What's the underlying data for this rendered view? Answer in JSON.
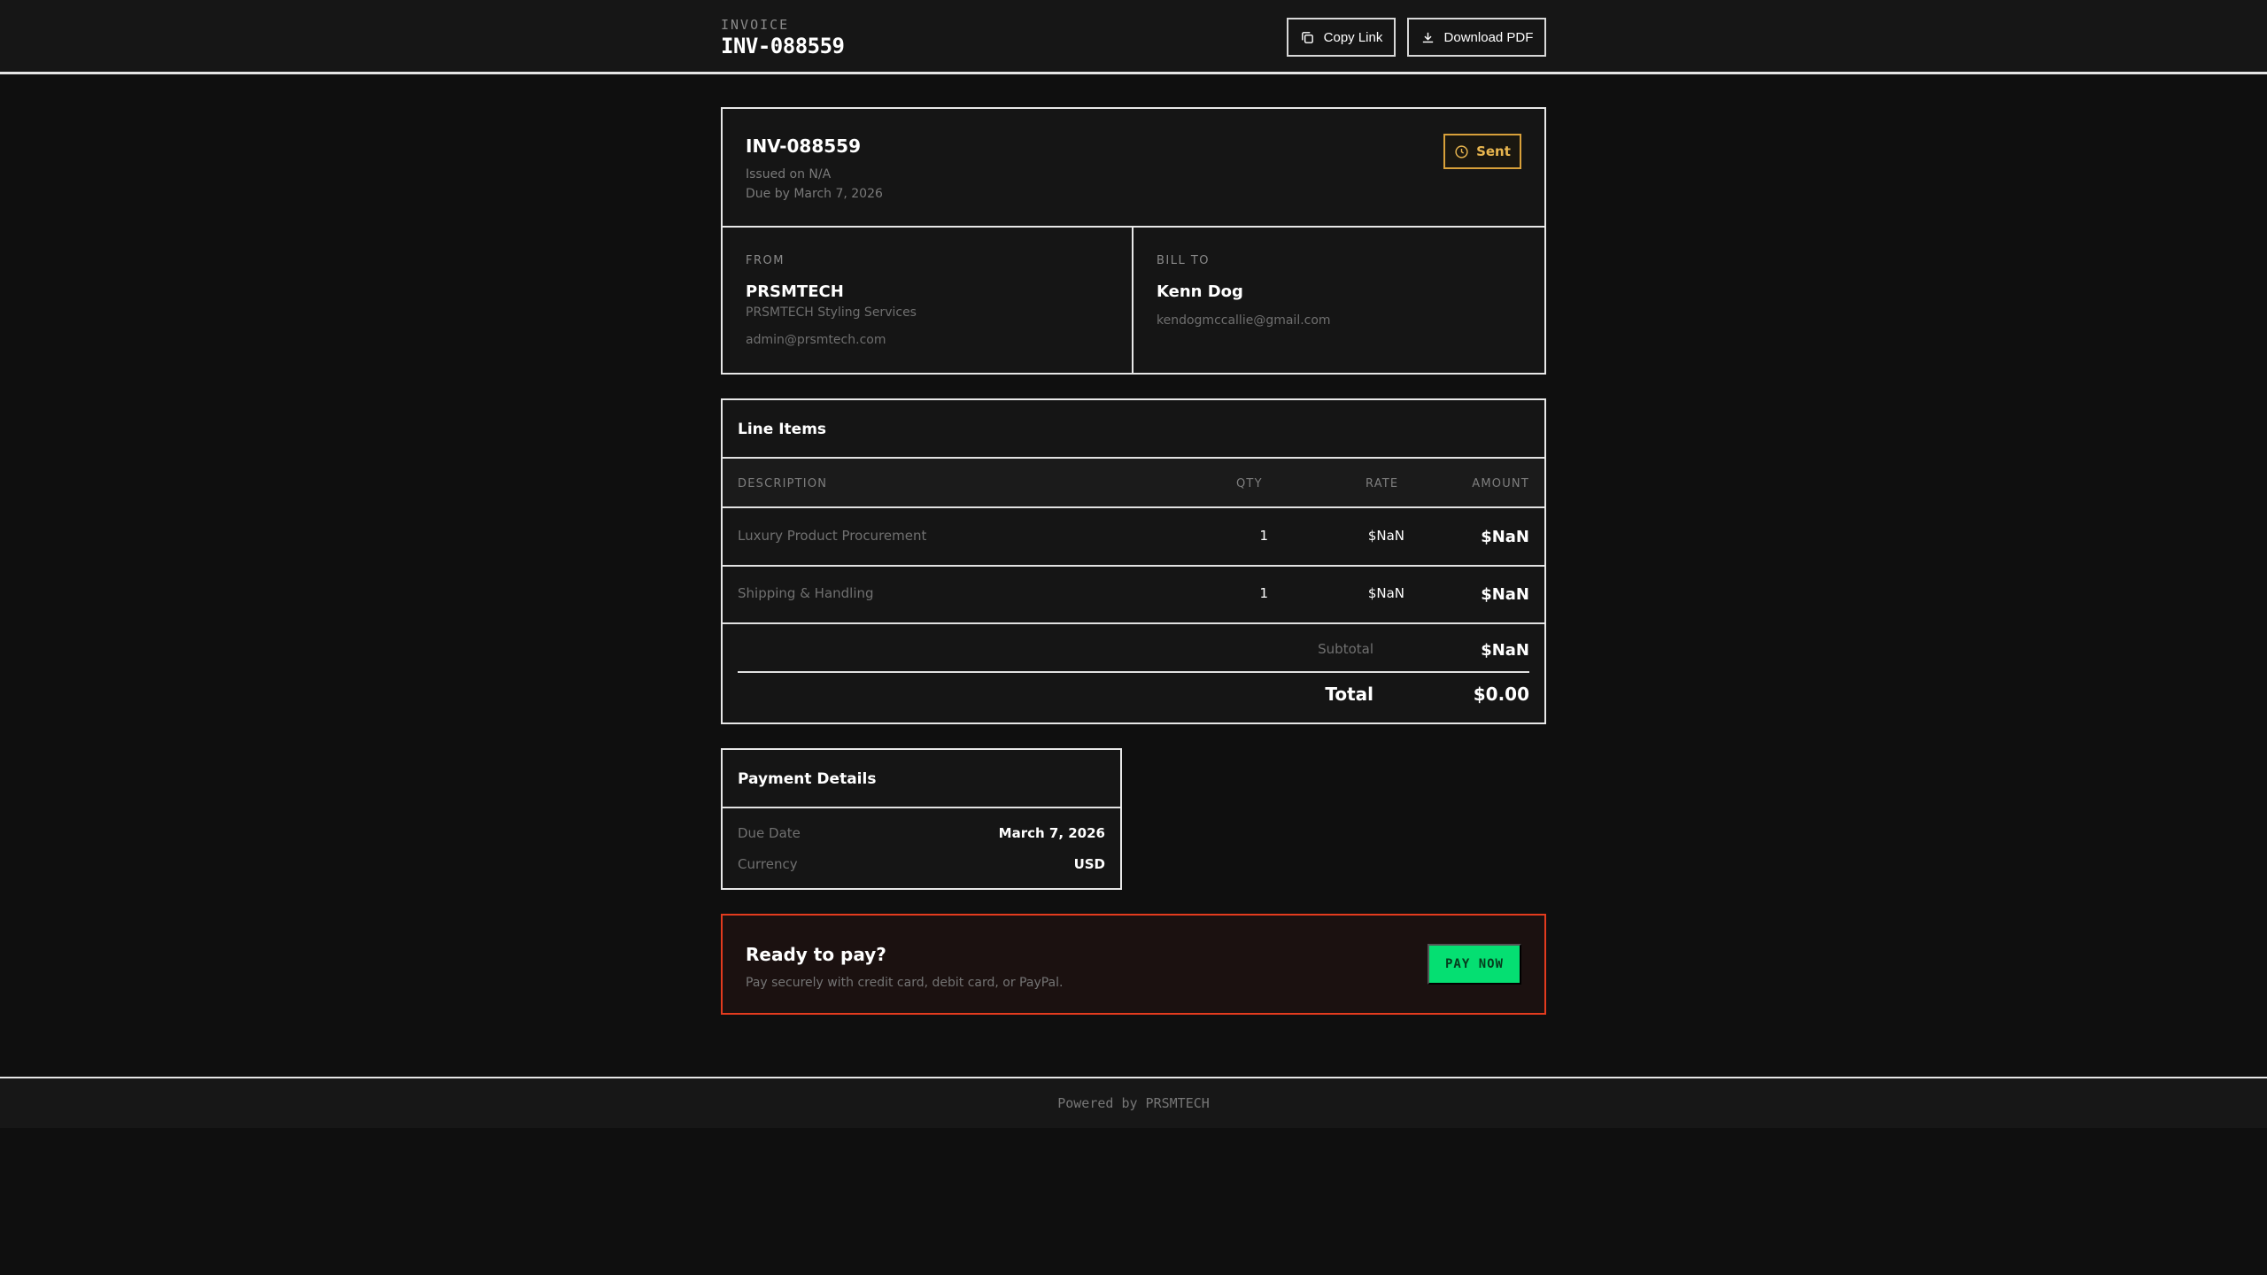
{
  "header": {
    "kicker": "INVOICE",
    "title": "INV-088559",
    "copy_label": "Copy Link",
    "download_label": "Download PDF"
  },
  "invoice": {
    "number": "INV-088559",
    "issued": "Issued on N/A",
    "due": "Due by March 7, 2026",
    "status": "Sent"
  },
  "from": {
    "label": "FROM",
    "name": "PRSMTECH",
    "company": "PRSMTECH Styling Services",
    "email": "admin@prsmtech.com"
  },
  "bill_to": {
    "label": "BILL TO",
    "name": "Kenn Dog",
    "email": "kendogmccallie@gmail.com"
  },
  "line_items": {
    "title": "Line Items",
    "columns": [
      "DESCRIPTION",
      "QTY",
      "RATE",
      "AMOUNT"
    ],
    "rows": [
      {
        "description": "Luxury Product Procurement",
        "qty": "1",
        "rate": "$NaN",
        "amount": "$NaN"
      },
      {
        "description": "Shipping & Handling",
        "qty": "1",
        "rate": "$NaN",
        "amount": "$NaN"
      }
    ],
    "subtotal_label": "Subtotal",
    "subtotal_value": "$NaN",
    "total_label": "Total",
    "total_value": "$0.00"
  },
  "payment_details": {
    "title": "Payment Details",
    "rows": [
      {
        "label": "Due Date",
        "value": "March 7, 2026"
      },
      {
        "label": "Currency",
        "value": "USD"
      }
    ]
  },
  "cta": {
    "title": "Ready to pay?",
    "subtitle": "Pay securely with credit card, debit card, or PayPal.",
    "button": "PAY NOW"
  },
  "footer": {
    "text": "Powered by PRSMTECH"
  },
  "colors": {
    "accent_status": "#e9b64f",
    "accent_cta_border": "#e33b1e",
    "accent_pay": "#05df72"
  },
  "icons": {
    "copy": "copy-icon",
    "download": "download-icon",
    "status": "clock-icon"
  }
}
